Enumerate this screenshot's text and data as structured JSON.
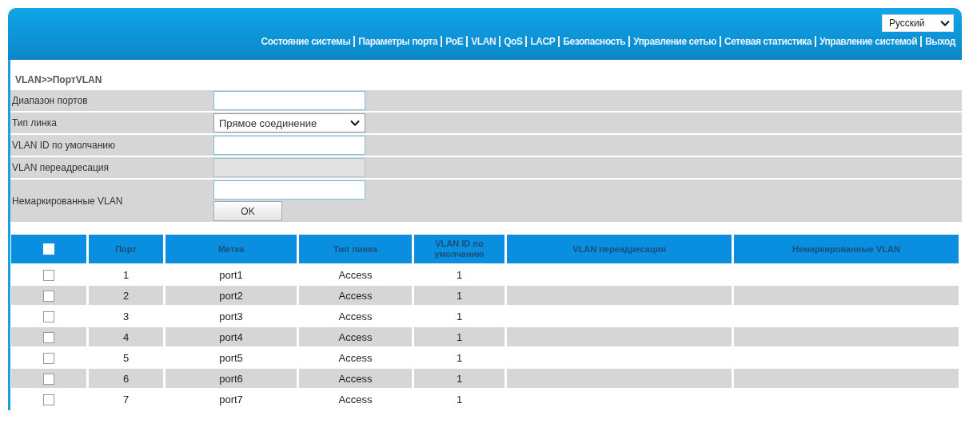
{
  "language": {
    "value": "Русский"
  },
  "nav": [
    {
      "label": "Состояние системы"
    },
    {
      "label": "Параметры порта"
    },
    {
      "label": "PoE"
    },
    {
      "label": "VLAN"
    },
    {
      "label": "QoS"
    },
    {
      "label": "LACP"
    },
    {
      "label": "Безопасность"
    },
    {
      "label": "Управление сетью"
    },
    {
      "label": "Сетевая статистика"
    },
    {
      "label": "Управление системой"
    },
    {
      "label": "Выход"
    }
  ],
  "breadcrumb": "VLAN>>ПортVLAN",
  "form": {
    "fields": [
      {
        "label": "Диапазон портов",
        "kind": "text",
        "disabled": false
      },
      {
        "label": "Тип линка",
        "kind": "select",
        "value": "Прямое соединение",
        "disabled": false
      },
      {
        "label": "VLAN ID по умолчанию",
        "kind": "text",
        "disabled": false
      },
      {
        "label": "VLAN переадресация",
        "kind": "text",
        "disabled": true
      },
      {
        "label": "Немаркированные VLAN",
        "kind": "text",
        "disabled": false
      }
    ],
    "submit": "OK"
  },
  "table": {
    "select_all": {
      "checked": false
    },
    "columns": [
      "Порт",
      "Метка",
      "Тип линка",
      "VLAN ID по умолчанию",
      "VLAN переадресация",
      "Немаркированные VLAN"
    ],
    "rows": [
      {
        "checked": false,
        "cells": [
          "1",
          "port1",
          "Access",
          "1"
        ]
      },
      {
        "checked": false,
        "cells": [
          "2",
          "port2",
          "Access",
          "1"
        ]
      },
      {
        "checked": false,
        "cells": [
          "3",
          "port3",
          "Access",
          "1"
        ]
      },
      {
        "checked": false,
        "cells": [
          "4",
          "port4",
          "Access",
          "1"
        ]
      },
      {
        "checked": false,
        "cells": [
          "5",
          "port5",
          "Access",
          "1"
        ]
      },
      {
        "checked": false,
        "cells": [
          "6",
          "port6",
          "Access",
          "1"
        ]
      },
      {
        "checked": false,
        "cells": [
          "7",
          "port7",
          "Access",
          "1"
        ]
      }
    ]
  }
}
